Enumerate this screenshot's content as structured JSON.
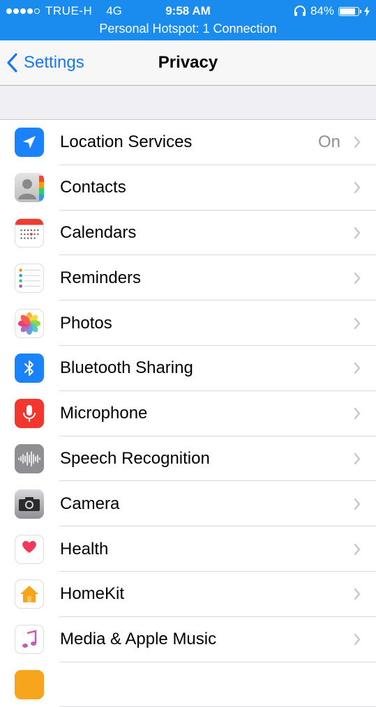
{
  "status_bar": {
    "carrier": "TRUE-H",
    "network": "4G",
    "time": "9:58 AM",
    "battery": "84%",
    "battery_level": 0.84,
    "hotspot": "Personal Hotspot: 1 Connection",
    "background_color": "#1a8cf0"
  },
  "nav": {
    "back_label": "Settings",
    "title": "Privacy",
    "accent_color": "#1478f0"
  },
  "rows": [
    {
      "label": "Location Services",
      "value": "On",
      "icon": "location-arrow-icon"
    },
    {
      "label": "Contacts",
      "value": "",
      "icon": "contacts-icon"
    },
    {
      "label": "Calendars",
      "value": "",
      "icon": "calendar-icon"
    },
    {
      "label": "Reminders",
      "value": "",
      "icon": "reminders-icon"
    },
    {
      "label": "Photos",
      "value": "",
      "icon": "photos-icon"
    },
    {
      "label": "Bluetooth Sharing",
      "value": "",
      "icon": "bluetooth-icon"
    },
    {
      "label": "Microphone",
      "value": "",
      "icon": "microphone-icon"
    },
    {
      "label": "Speech Recognition",
      "value": "",
      "icon": "waveform-icon"
    },
    {
      "label": "Camera",
      "value": "",
      "icon": "camera-icon"
    },
    {
      "label": "Health",
      "value": "",
      "icon": "heart-icon"
    },
    {
      "label": "HomeKit",
      "value": "",
      "icon": "home-icon"
    },
    {
      "label": "Media & Apple Music",
      "value": "",
      "icon": "music-note-icon"
    }
  ]
}
